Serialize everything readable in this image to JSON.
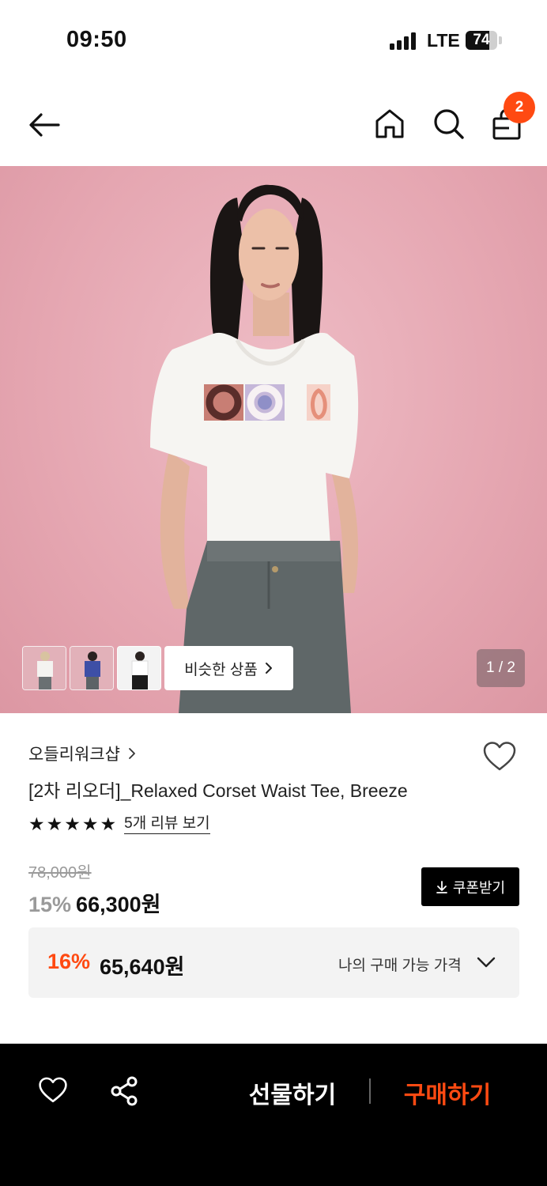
{
  "status_bar": {
    "time": "09:50",
    "network": "LTE",
    "battery": "74",
    "battery_level": 0.74
  },
  "header": {
    "back_icon": "arrow-left-icon",
    "home_icon": "home-icon",
    "search_icon": "search-icon",
    "cart_icon": "shopping-bag-icon",
    "cart_count": "2"
  },
  "gallery": {
    "similar_label": "비슷한 상품",
    "page_indicator": "1 / 2",
    "thumbnails": [
      "thumb-white-tee",
      "thumb-blue-tee",
      "thumb-white-tee-black-skirt"
    ]
  },
  "product": {
    "brand": "오들리워크샵",
    "title": "[2차 리오더]_Relaxed Corset Waist Tee, Breeze",
    "rating_stars": 5,
    "review_link": "5개 리뷰 보기",
    "original_price": "78,000원",
    "discount": "15%",
    "sale_price": "66,300원",
    "coupon_label": "쿠폰받기"
  },
  "my_price": {
    "discount": "16%",
    "price": "65,640원",
    "label": "나의 구매 가능 가격"
  },
  "bottom_bar": {
    "gift_label": "선물하기",
    "buy_label": "구매하기"
  },
  "colors": {
    "accent": "#ff4a12",
    "hero_bg": "#e7aab5",
    "bar_bg": "#000000"
  }
}
